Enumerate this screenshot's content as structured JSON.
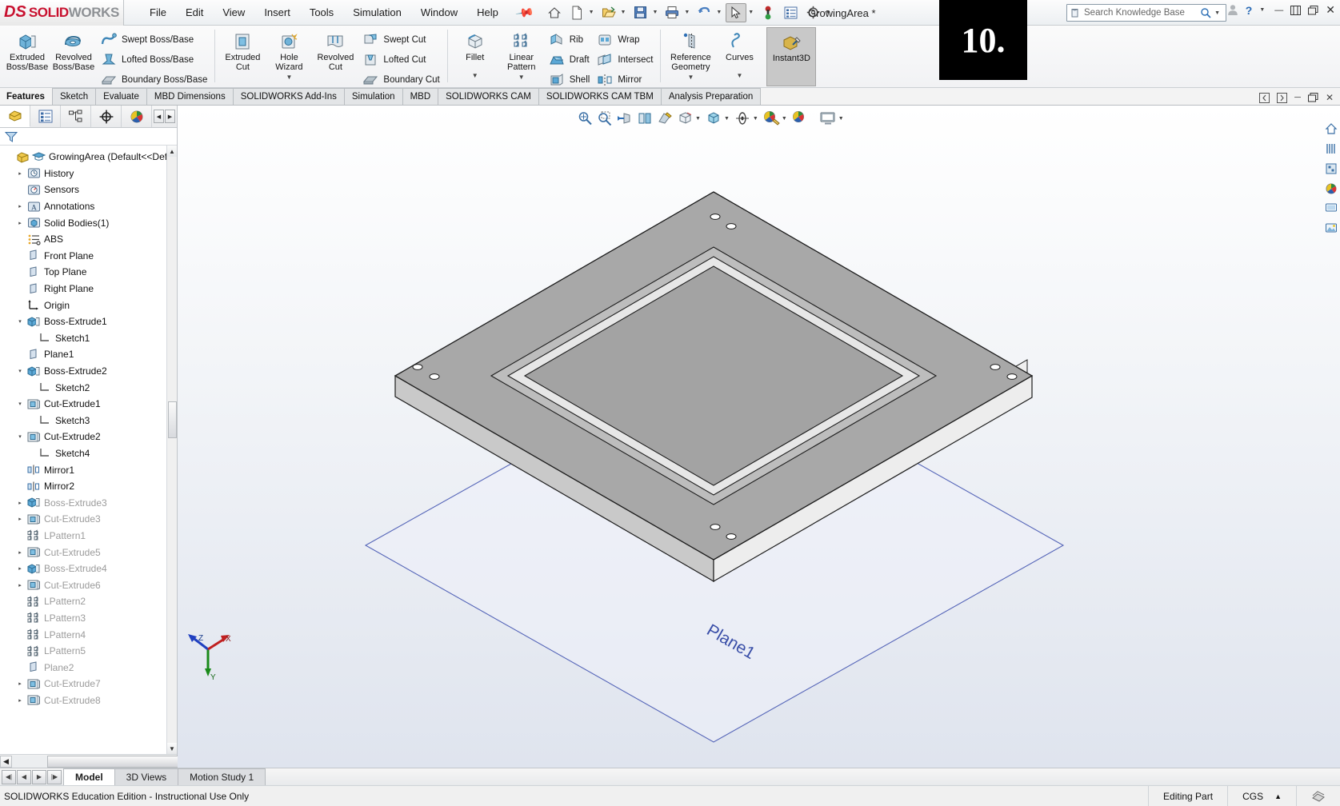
{
  "app": {
    "brand_ds": "DS",
    "brand_solid": "SOLID",
    "brand_works": "WORKS",
    "document_title": "GrowingArea *",
    "overlay_number": "10."
  },
  "menubar": {
    "items": [
      "File",
      "Edit",
      "View",
      "Insert",
      "Tools",
      "Simulation",
      "Window",
      "Help"
    ]
  },
  "quick_access": {
    "icons": [
      "pin-icon",
      "home-icon",
      "new-document-icon",
      "open-icon",
      "save-icon",
      "print-icon",
      "undo-icon",
      "select-icon",
      "rebuild-icon",
      "options-list-icon",
      "settings-gear-icon"
    ]
  },
  "search": {
    "placeholder": "Search Knowledge Base",
    "icon": "search-icon"
  },
  "window_controls": {
    "user": "user-icon",
    "help": "?",
    "help_caret": "▾",
    "minimize": "—",
    "restore": "restore-icon",
    "maximize": "maximize-icon",
    "close": "✕"
  },
  "ribbon": {
    "groups": [
      {
        "big": [
          {
            "label_line1": "Extruded",
            "label_line2": "Boss/Base",
            "icon": "extruded-boss-icon"
          },
          {
            "label_line1": "Revolved",
            "label_line2": "Boss/Base",
            "icon": "revolved-boss-icon"
          }
        ],
        "stacked": [
          {
            "label": "Swept Boss/Base",
            "icon": "swept-boss-icon"
          },
          {
            "label": "Lofted Boss/Base",
            "icon": "lofted-boss-icon"
          },
          {
            "label": "Boundary Boss/Base",
            "icon": "boundary-boss-icon"
          }
        ]
      },
      {
        "big": [
          {
            "label_line1": "Extruded",
            "label_line2": "Cut",
            "icon": "extruded-cut-icon",
            "has_caret": true
          },
          {
            "label_line1": "Hole",
            "label_line2": "Wizard",
            "icon": "hole-wizard-icon",
            "has_caret": true
          },
          {
            "label_line1": "Revolved",
            "label_line2": "Cut",
            "icon": "revolved-cut-icon"
          }
        ],
        "stacked": [
          {
            "label": "Swept Cut",
            "icon": "swept-cut-icon"
          },
          {
            "label": "Lofted Cut",
            "icon": "lofted-cut-icon"
          },
          {
            "label": "Boundary Cut",
            "icon": "boundary-cut-icon"
          }
        ]
      },
      {
        "big": [
          {
            "label_line1": "Fillet",
            "label_line2": "",
            "icon": "fillet-icon",
            "has_caret": true
          },
          {
            "label_line1": "Linear",
            "label_line2": "Pattern",
            "icon": "linear-pattern-icon",
            "has_caret": true
          }
        ],
        "stacked": [
          {
            "label": "Rib",
            "icon": "rib-icon"
          },
          {
            "label": "Draft",
            "icon": "draft-icon"
          },
          {
            "label": "Shell",
            "icon": "shell-icon"
          }
        ],
        "stacked2": [
          {
            "label": "Wrap",
            "icon": "wrap-icon"
          },
          {
            "label": "Intersect",
            "icon": "intersect-icon"
          },
          {
            "label": "Mirror",
            "icon": "mirror-icon"
          }
        ]
      },
      {
        "big": [
          {
            "label_line1": "Reference",
            "label_line2": "Geometry",
            "icon": "reference-geometry-icon",
            "has_caret": true
          },
          {
            "label_line1": "Curves",
            "label_line2": "",
            "icon": "curves-icon",
            "has_caret": true
          }
        ]
      }
    ],
    "instant3d": {
      "label": "Instant3D",
      "icon": "instant3d-icon"
    }
  },
  "command_tabs": {
    "items": [
      {
        "label": "Features",
        "active": false,
        "first": true
      },
      {
        "label": "Sketch",
        "active": false
      },
      {
        "label": "Evaluate",
        "active": false
      },
      {
        "label": "MBD Dimensions",
        "active": false
      },
      {
        "label": "SOLIDWORKS Add-Ins",
        "active": false
      },
      {
        "label": "Simulation",
        "active": false
      },
      {
        "label": "MBD",
        "active": false
      },
      {
        "label": "SOLIDWORKS CAM",
        "active": false
      },
      {
        "label": "SOLIDWORKS CAM TBM",
        "active": false
      },
      {
        "label": "Analysis Preparation",
        "active": false
      }
    ],
    "right_icons": [
      "collapse-left-icon",
      "expand-right-icon",
      "minimize-icon",
      "restore-window-icon",
      "close-window-icon"
    ]
  },
  "feature_manager": {
    "tabs": [
      {
        "name": "feature-tree-tab",
        "icon": "feature-tree-icon",
        "active": true
      },
      {
        "name": "property-manager-tab",
        "icon": "property-manager-icon",
        "active": false
      },
      {
        "name": "configuration-manager-tab",
        "icon": "configuration-manager-icon",
        "active": false
      },
      {
        "name": "dimxpert-manager-tab",
        "icon": "dimxpert-icon",
        "active": false
      },
      {
        "name": "display-manager-tab",
        "icon": "display-manager-icon",
        "active": false
      }
    ],
    "filter_placeholder": "",
    "filter_icon": "filter-icon",
    "tree": [
      {
        "label": "GrowingArea  (Default<<Defau",
        "icon": "part-icon",
        "indent": 0,
        "twist": "",
        "dim": false,
        "root": true
      },
      {
        "label": "History",
        "icon": "history-icon",
        "indent": 1,
        "twist": "▸",
        "dim": false
      },
      {
        "label": "Sensors",
        "icon": "sensors-icon",
        "indent": 1,
        "twist": "",
        "dim": false
      },
      {
        "label": "Annotations",
        "icon": "annotations-icon",
        "indent": 1,
        "twist": "▸",
        "dim": false
      },
      {
        "label": "Solid Bodies(1)",
        "icon": "solid-bodies-icon",
        "indent": 1,
        "twist": "▸",
        "dim": false
      },
      {
        "label": "ABS",
        "icon": "material-icon",
        "indent": 1,
        "twist": "",
        "dim": false
      },
      {
        "label": "Front Plane",
        "icon": "plane-icon",
        "indent": 1,
        "twist": "",
        "dim": false
      },
      {
        "label": "Top Plane",
        "icon": "plane-icon",
        "indent": 1,
        "twist": "",
        "dim": false
      },
      {
        "label": "Right Plane",
        "icon": "plane-icon",
        "indent": 1,
        "twist": "",
        "dim": false
      },
      {
        "label": "Origin",
        "icon": "origin-icon",
        "indent": 1,
        "twist": "",
        "dim": false
      },
      {
        "label": "Boss-Extrude1",
        "icon": "boss-extrude-icon",
        "indent": 1,
        "twist": "▾",
        "dim": false
      },
      {
        "label": "Sketch1",
        "icon": "sketch-icon",
        "indent": 2,
        "twist": "",
        "dim": false
      },
      {
        "label": "Plane1",
        "icon": "plane-icon",
        "indent": 1,
        "twist": "",
        "dim": false
      },
      {
        "label": "Boss-Extrude2",
        "icon": "boss-extrude-icon",
        "indent": 1,
        "twist": "▾",
        "dim": false
      },
      {
        "label": "Sketch2",
        "icon": "sketch-icon",
        "indent": 2,
        "twist": "",
        "dim": false
      },
      {
        "label": "Cut-Extrude1",
        "icon": "cut-extrude-icon",
        "indent": 1,
        "twist": "▾",
        "dim": false
      },
      {
        "label": "Sketch3",
        "icon": "sketch-icon",
        "indent": 2,
        "twist": "",
        "dim": false
      },
      {
        "label": "Cut-Extrude2",
        "icon": "cut-extrude-icon",
        "indent": 1,
        "twist": "▾",
        "dim": false
      },
      {
        "label": "Sketch4",
        "icon": "sketch-icon",
        "indent": 2,
        "twist": "",
        "dim": false
      },
      {
        "label": "Mirror1",
        "icon": "mirror-feature-icon",
        "indent": 1,
        "twist": "",
        "dim": false
      },
      {
        "label": "Mirror2",
        "icon": "mirror-feature-icon",
        "indent": 1,
        "twist": "",
        "dim": false
      },
      {
        "label": "Boss-Extrude3",
        "icon": "boss-extrude-icon",
        "indent": 1,
        "twist": "▸",
        "dim": true
      },
      {
        "label": "Cut-Extrude3",
        "icon": "cut-extrude-icon",
        "indent": 1,
        "twist": "▸",
        "dim": true
      },
      {
        "label": "LPattern1",
        "icon": "lpattern-icon",
        "indent": 1,
        "twist": "",
        "dim": true
      },
      {
        "label": "Cut-Extrude5",
        "icon": "cut-extrude-icon",
        "indent": 1,
        "twist": "▸",
        "dim": true
      },
      {
        "label": "Boss-Extrude4",
        "icon": "boss-extrude-icon",
        "indent": 1,
        "twist": "▸",
        "dim": true
      },
      {
        "label": "Cut-Extrude6",
        "icon": "cut-extrude-icon",
        "indent": 1,
        "twist": "▸",
        "dim": true
      },
      {
        "label": "LPattern2",
        "icon": "lpattern-icon",
        "indent": 1,
        "twist": "",
        "dim": true
      },
      {
        "label": "LPattern3",
        "icon": "lpattern-icon",
        "indent": 1,
        "twist": "",
        "dim": true
      },
      {
        "label": "LPattern4",
        "icon": "lpattern-icon",
        "indent": 1,
        "twist": "",
        "dim": true
      },
      {
        "label": "LPattern5",
        "icon": "lpattern-icon",
        "indent": 1,
        "twist": "",
        "dim": true
      },
      {
        "label": "Plane2",
        "icon": "plane-icon",
        "indent": 1,
        "twist": "",
        "dim": true
      },
      {
        "label": "Cut-Extrude7",
        "icon": "cut-extrude-icon",
        "indent": 1,
        "twist": "▸",
        "dim": true
      },
      {
        "label": "Cut-Extrude8",
        "icon": "cut-extrude-icon",
        "indent": 1,
        "twist": "▸",
        "dim": true
      }
    ]
  },
  "view_toolbar": {
    "items": [
      {
        "name": "zoom-to-fit-icon"
      },
      {
        "name": "zoom-to-area-icon"
      },
      {
        "name": "section-view-icon"
      },
      {
        "name": "view-orientation-icon"
      },
      {
        "name": "display-style-icon"
      },
      {
        "name": "hide-show-items-icon",
        "caret": true
      },
      {
        "name": "view-settings-icon",
        "caret": true
      },
      {
        "name": "appearances-icon",
        "caret": true
      },
      {
        "name": "scene-icon",
        "caret": true
      },
      {
        "name": "apply-scene-icon"
      },
      {
        "name": "viewport-layout-icon",
        "caret": true
      }
    ]
  },
  "right_toolbar": {
    "items": [
      "view-home-icon",
      "view-front-icon",
      "view-section-icon",
      "view-appearance-icon",
      "view-display-icon",
      "view-scene-icon"
    ]
  },
  "viewport": {
    "plane_label": "Plane1",
    "triad": {
      "x_label": "X",
      "y_label": "Y",
      "z_label": "Z"
    },
    "model_name": "GrowingArea"
  },
  "bottom_tabs": {
    "nav_buttons": [
      "first-sheet-icon",
      "prev-sheet-icon",
      "next-sheet-icon",
      "last-sheet-icon"
    ],
    "items": [
      {
        "label": "Model",
        "active": true
      },
      {
        "label": "3D Views",
        "active": false
      },
      {
        "label": "Motion Study 1",
        "active": false
      }
    ]
  },
  "status_bar": {
    "left_text": "SOLIDWORKS Education Edition - Instructional Use Only",
    "editing_state": "Editing Part",
    "units": "CGS",
    "units_caret": "▴",
    "overlay_icon": "overlay-icon"
  }
}
